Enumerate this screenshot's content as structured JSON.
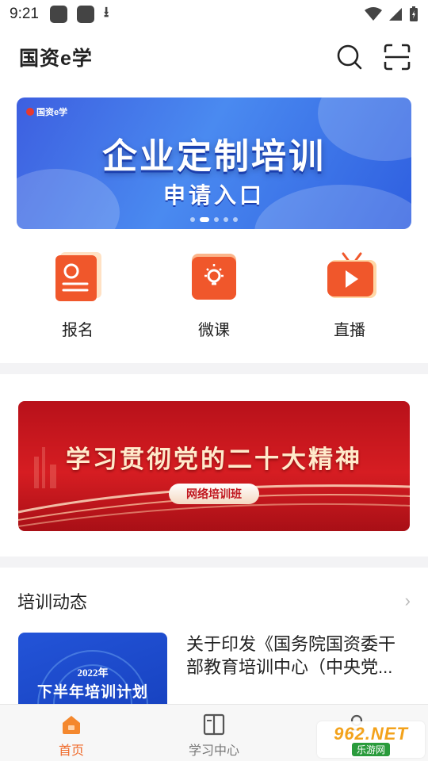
{
  "status_bar": {
    "time": "9:21"
  },
  "header": {
    "title": "国资e学"
  },
  "banner_top": {
    "logo_text": "国资e学",
    "title": "企业定制培训",
    "subtitle": "申请入口",
    "dots_total": 5,
    "dot_active": 1
  },
  "quick_entries": [
    {
      "label": "报名",
      "icon": "signup-icon"
    },
    {
      "label": "微课",
      "icon": "microcourse-icon"
    },
    {
      "label": "直播",
      "icon": "live-icon"
    }
  ],
  "banner_mid": {
    "title": "学习贯彻党的二十大精神",
    "pill": "网络培训班"
  },
  "section": {
    "title": "培训动态"
  },
  "news": {
    "thumb_year": "2022年",
    "thumb_title": "下半年培训计划",
    "text": "关于印发《国务院国资委干部教育培训中心（中央党..."
  },
  "bottom_nav": [
    {
      "label": "首页",
      "icon": "home-icon",
      "active": true
    },
    {
      "label": "学习中心",
      "icon": "book-icon",
      "active": false
    },
    {
      "label": "",
      "icon": "person-icon",
      "active": false
    }
  ],
  "watermark": {
    "top": "962.NET",
    "bottom": "乐游网"
  },
  "colors": {
    "accent": "#ef6a2a",
    "banner_blue": "#3d5fe0",
    "banner_red": "#d61d22"
  }
}
